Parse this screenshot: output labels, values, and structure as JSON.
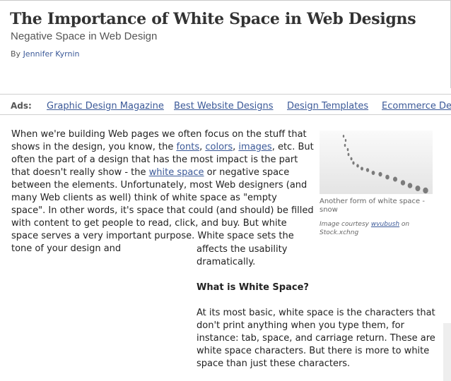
{
  "article": {
    "title": "The Importance of White Space in Web Designs",
    "subtitle": "Negative Space in Web Design",
    "byline_prefix": "By ",
    "author": "Jennifer Kyrnin"
  },
  "ads": {
    "label": "Ads:",
    "links": [
      "Graphic Design Magazine",
      "Best Website Designs",
      "Design Templates",
      "Ecommerce Des"
    ]
  },
  "paragraph1": {
    "t1": "When we're building Web pages we often focus on the stuff that shows in the design, you know, the ",
    "link_fonts": "fonts",
    "s1": ", ",
    "link_colors": "colors",
    "s2": ", ",
    "link_images": "images",
    "t2": ", etc. But often the part of a design that has the most impact is the part that doesn't really show - the ",
    "link_white_space": "white space",
    "t3": " or negative space between the elements. Unfortunately, most Web designers (and many Web clients as well) think of white space as \"empty space\". In other words, it's space that could (and should) be filled with content to get people to read, click, and buy. But white space serves a very important purpose. White space sets the tone of your design and",
    "continuation": "affects the usability dramatically."
  },
  "figure": {
    "icon": "footprints-in-snow-photo",
    "caption": "Another form of white space - snow",
    "credit_prefix": "Image courtesy ",
    "credit_user": "wvubush",
    "credit_mid": " on",
    "credit_site": "Stock.xchng"
  },
  "section": {
    "heading": "What is White Space?",
    "paragraph": "At its most basic, white space is the characters that don't print anything when you type them, for instance: tab, space, and carriage return. These are white space characters. But there is more to white space than just these characters."
  },
  "colors": {
    "link": "#3b5998",
    "text": "#222222",
    "border": "#cfcfcf"
  }
}
